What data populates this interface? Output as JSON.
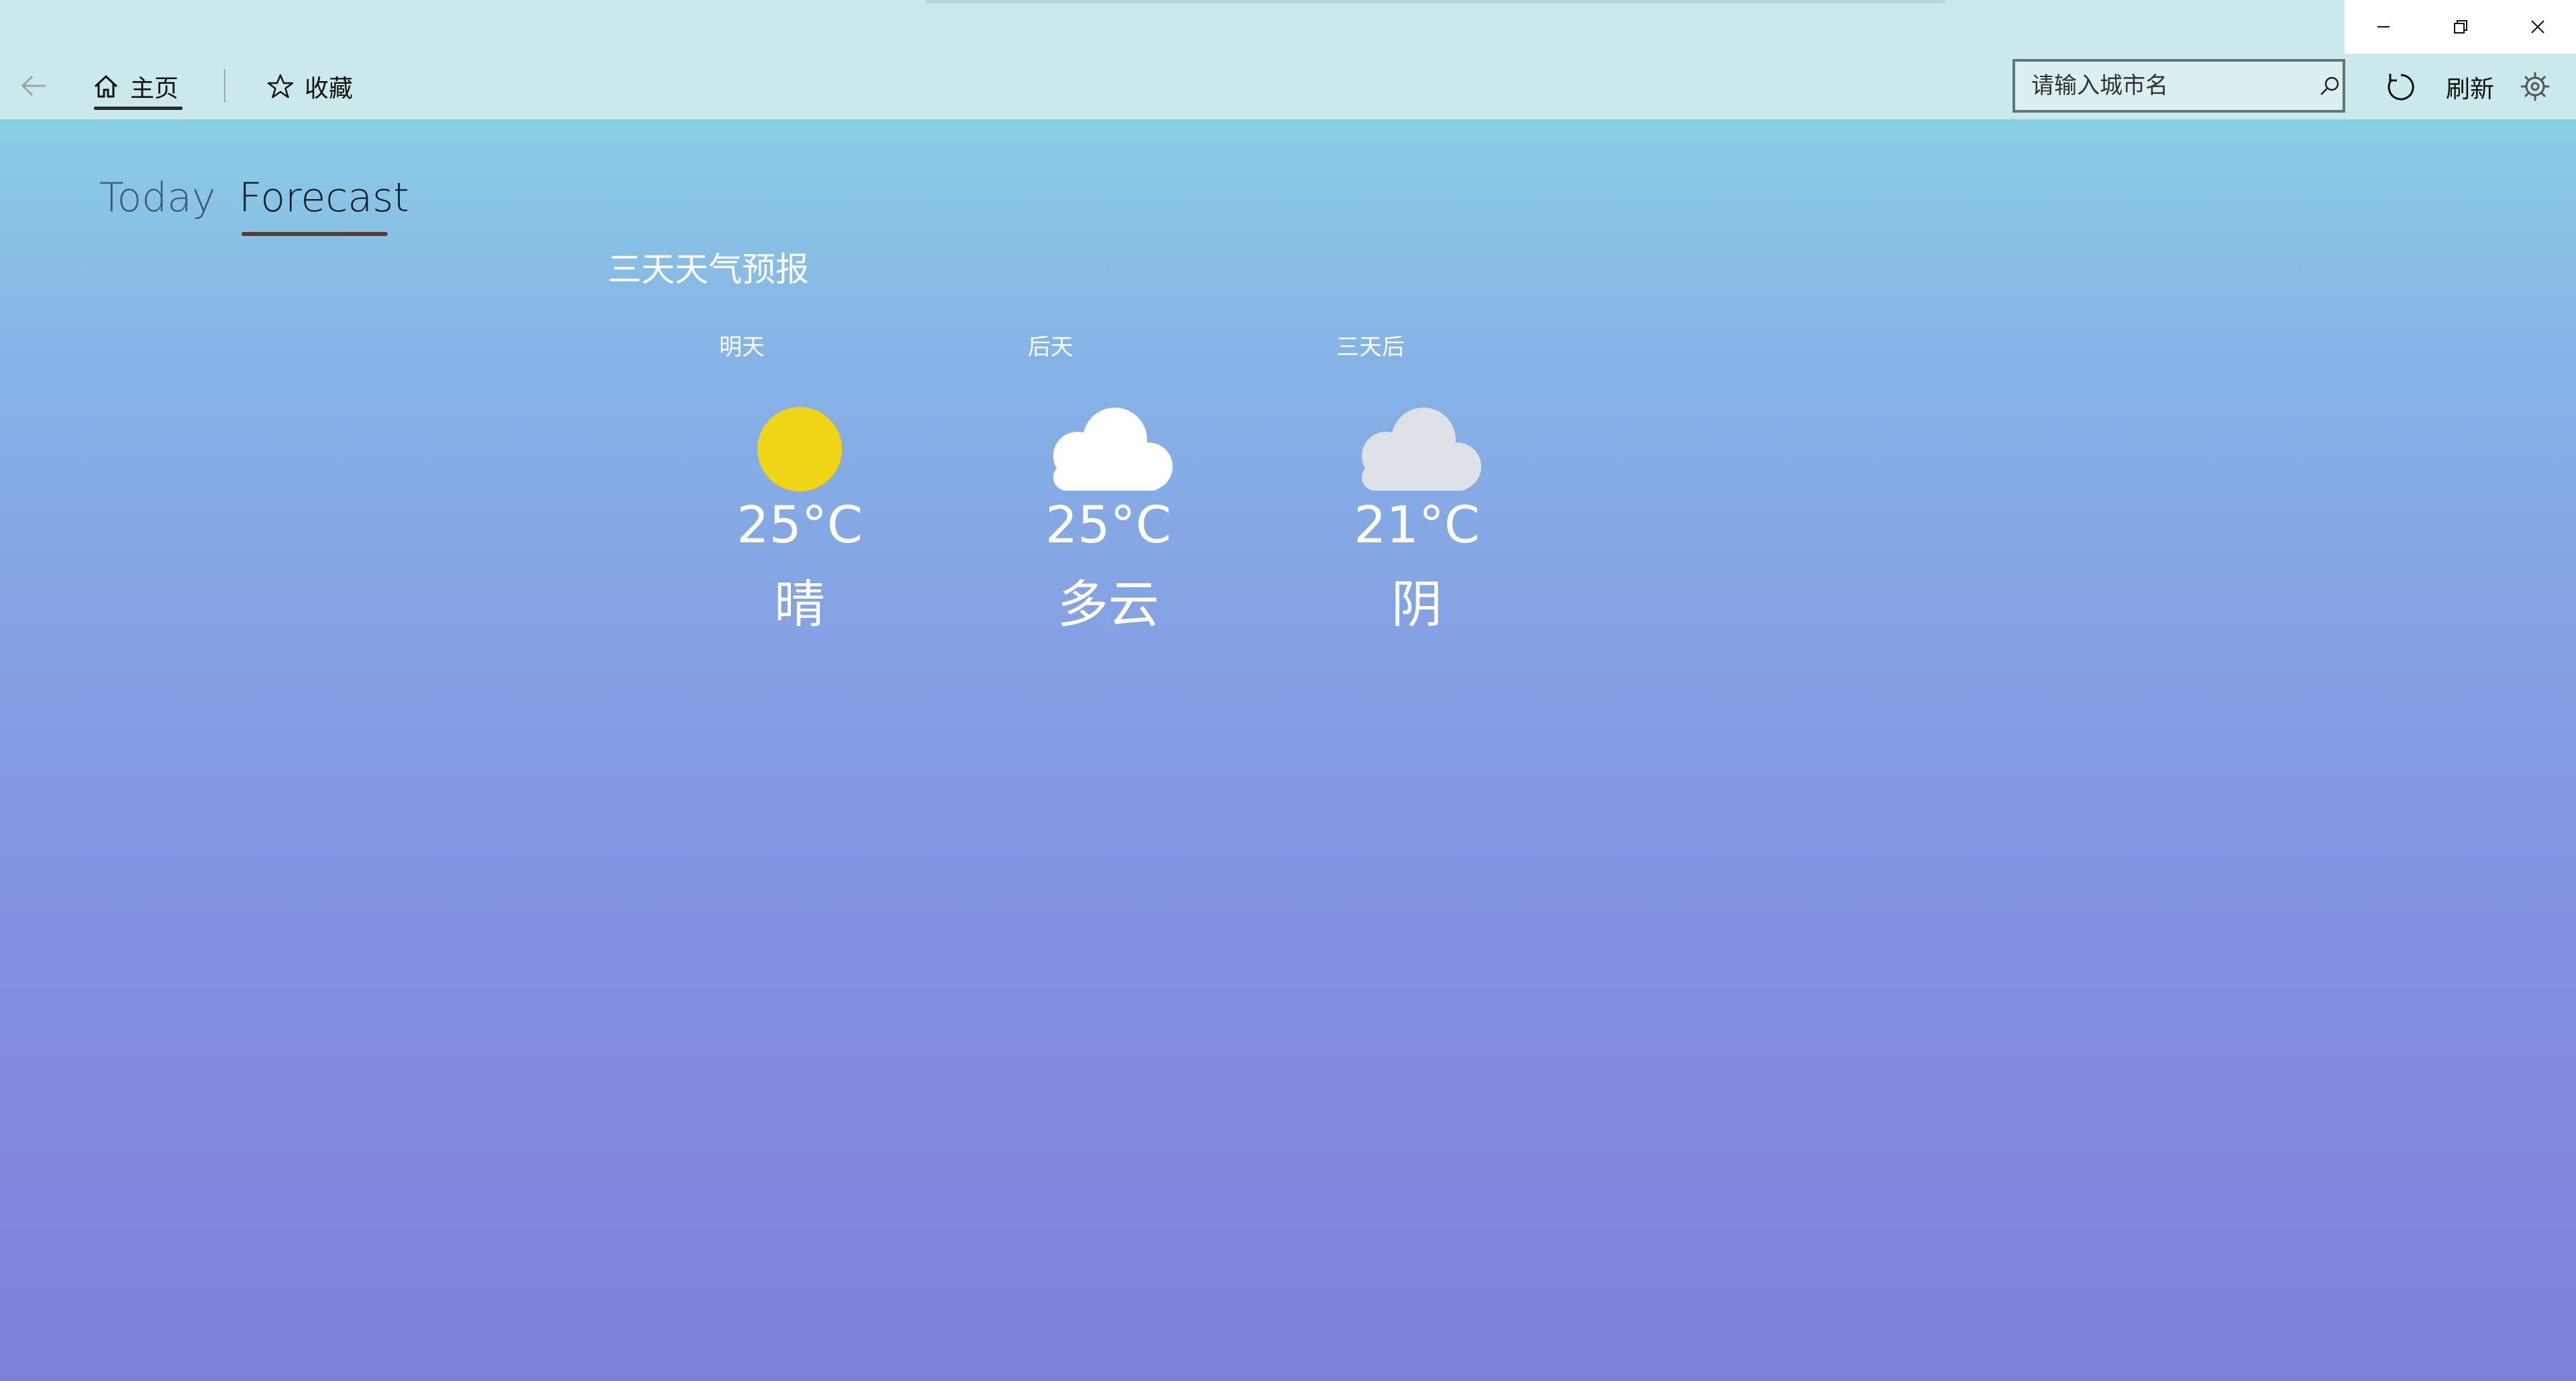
{
  "window": {
    "controls": {
      "minimize_icon": "minimize-icon",
      "restore_icon": "restore-icon",
      "close_icon": "close-icon"
    }
  },
  "nav": {
    "back_icon": "back-arrow-icon",
    "home_label": "主页",
    "home_icon": "home-icon",
    "favorites_label": "收藏",
    "favorites_icon": "star-icon"
  },
  "search": {
    "placeholder": "请输入城市名",
    "value": "",
    "icon": "search-icon"
  },
  "toolbar": {
    "refresh_label": "刷新",
    "refresh_icon": "refresh-icon",
    "settings_icon": "gear-icon"
  },
  "tabs": [
    {
      "label": "Today",
      "selected": false
    },
    {
      "label": "Forecast",
      "selected": true
    }
  ],
  "forecast": {
    "title": "三天天气预报",
    "days": [
      {
        "label": "明天",
        "temp": "25°C",
        "condition": "晴",
        "icon": "sun-icon"
      },
      {
        "label": "后天",
        "temp": "25°C",
        "condition": "多云",
        "icon": "cloud-icon"
      },
      {
        "label": "三天后",
        "temp": "21°C",
        "condition": "阴",
        "icon": "overcast-cloud-icon"
      }
    ]
  },
  "colors": {
    "sun": "#f0d416",
    "cloud": "#ffffff",
    "overcast_cloud": "#dde1e8",
    "titlebar": "#cbe9ea",
    "gradient_top": "#8ddce3",
    "gradient_bottom": "#7f7fd8"
  }
}
